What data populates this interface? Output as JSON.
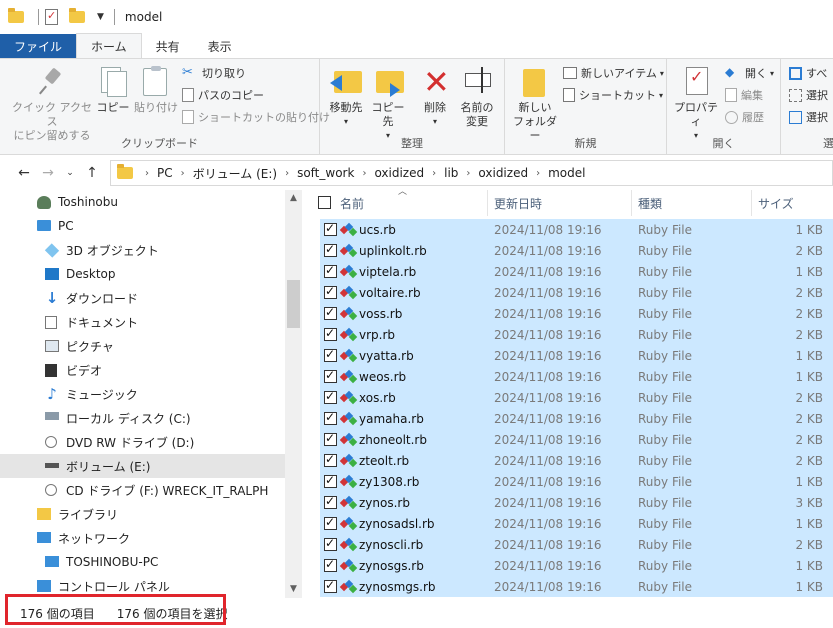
{
  "window": {
    "title": "model"
  },
  "ribbon_tabs": [
    "ファイル",
    "ホーム",
    "共有",
    "表示"
  ],
  "ribbon": {
    "clipboard": {
      "pin_label_1": "クイック アクセス",
      "pin_label_2": "にピン留めする",
      "copy": "コピー",
      "paste": "貼り付け",
      "cut": "切り取り",
      "copy_path": "パスのコピー",
      "paste_shortcut": "ショートカットの貼り付け",
      "group_label": "クリップボード"
    },
    "organize": {
      "move_to": "移動先",
      "copy_to": "コピー先",
      "delete": "削除",
      "rename_1": "名前の",
      "rename_2": "変更",
      "group_label": "整理"
    },
    "new": {
      "new_folder_1": "新しい",
      "new_folder_2": "フォルダー",
      "new_item": "新しいアイテム",
      "shortcut": "ショートカット",
      "group_label": "新規"
    },
    "open": {
      "properties": "プロパティ",
      "open": "開く",
      "edit": "編集",
      "history": "履歴",
      "group_label": "開く"
    },
    "select": {
      "select_all": "すべ",
      "select_none": "選択",
      "invert": "選択",
      "group_label": "選"
    }
  },
  "address": {
    "crumbs": [
      "PC",
      "ボリューム (E:)",
      "soft_work",
      "oxidized",
      "lib",
      "oxidized",
      "model"
    ]
  },
  "nav": {
    "items": [
      {
        "label": "Toshinobu",
        "icon": "user-icon"
      },
      {
        "label": "PC",
        "icon": "pc-icon"
      },
      {
        "label": "3D オブジェクト",
        "icon": "3d-objects-icon"
      },
      {
        "label": "Desktop",
        "icon": "desktop-icon"
      },
      {
        "label": "ダウンロード",
        "icon": "download-icon"
      },
      {
        "label": "ドキュメント",
        "icon": "documents-icon"
      },
      {
        "label": "ピクチャ",
        "icon": "pictures-icon"
      },
      {
        "label": "ビデオ",
        "icon": "video-icon"
      },
      {
        "label": "ミュージック",
        "icon": "music-icon"
      },
      {
        "label": "ローカル ディスク (C:)",
        "icon": "local-disk-icon"
      },
      {
        "label": "DVD RW ドライブ (D:)",
        "icon": "dvd-drive-icon"
      },
      {
        "label": "ボリューム (E:)",
        "icon": "volume-drive-icon"
      },
      {
        "label": "CD ドライブ (F:) WRECK_IT_RALPH",
        "icon": "cd-drive-icon"
      },
      {
        "label": "ライブラリ",
        "icon": "library-icon"
      },
      {
        "label": "ネットワーク",
        "icon": "network-icon"
      },
      {
        "label": "TOSHINOBU-PC",
        "icon": "computer-icon"
      },
      {
        "label": "コントロール パネル",
        "icon": "control-panel-icon"
      }
    ]
  },
  "columns": {
    "name": "名前",
    "date": "更新日時",
    "type": "種類",
    "size": "サイズ"
  },
  "files": [
    {
      "name": "ucs.rb",
      "date": "2024/11/08 19:16",
      "type": "Ruby File",
      "size": "1 KB"
    },
    {
      "name": "uplinkolt.rb",
      "date": "2024/11/08 19:16",
      "type": "Ruby File",
      "size": "2 KB"
    },
    {
      "name": "viptela.rb",
      "date": "2024/11/08 19:16",
      "type": "Ruby File",
      "size": "1 KB"
    },
    {
      "name": "voltaire.rb",
      "date": "2024/11/08 19:16",
      "type": "Ruby File",
      "size": "2 KB"
    },
    {
      "name": "voss.rb",
      "date": "2024/11/08 19:16",
      "type": "Ruby File",
      "size": "2 KB"
    },
    {
      "name": "vrp.rb",
      "date": "2024/11/08 19:16",
      "type": "Ruby File",
      "size": "2 KB"
    },
    {
      "name": "vyatta.rb",
      "date": "2024/11/08 19:16",
      "type": "Ruby File",
      "size": "1 KB"
    },
    {
      "name": "weos.rb",
      "date": "2024/11/08 19:16",
      "type": "Ruby File",
      "size": "1 KB"
    },
    {
      "name": "xos.rb",
      "date": "2024/11/08 19:16",
      "type": "Ruby File",
      "size": "2 KB"
    },
    {
      "name": "yamaha.rb",
      "date": "2024/11/08 19:16",
      "type": "Ruby File",
      "size": "2 KB"
    },
    {
      "name": "zhoneolt.rb",
      "date": "2024/11/08 19:16",
      "type": "Ruby File",
      "size": "2 KB"
    },
    {
      "name": "zteolt.rb",
      "date": "2024/11/08 19:16",
      "type": "Ruby File",
      "size": "2 KB"
    },
    {
      "name": "zy1308.rb",
      "date": "2024/11/08 19:16",
      "type": "Ruby File",
      "size": "1 KB"
    },
    {
      "name": "zynos.rb",
      "date": "2024/11/08 19:16",
      "type": "Ruby File",
      "size": "3 KB"
    },
    {
      "name": "zynosadsl.rb",
      "date": "2024/11/08 19:16",
      "type": "Ruby File",
      "size": "1 KB"
    },
    {
      "name": "zynoscli.rb",
      "date": "2024/11/08 19:16",
      "type": "Ruby File",
      "size": "2 KB"
    },
    {
      "name": "zynosgs.rb",
      "date": "2024/11/08 19:16",
      "type": "Ruby File",
      "size": "1 KB"
    },
    {
      "name": "zynosmgs.rb",
      "date": "2024/11/08 19:16",
      "type": "Ruby File",
      "size": "1 KB"
    }
  ],
  "status": {
    "item_count": "176 個の項目",
    "selected_count": "176 個の項目を選択"
  },
  "colors": {
    "file_tab": "#1f5fa8",
    "selection": "#cce8ff",
    "highlight_box": "#e0252c",
    "folder": "#f3c845"
  }
}
